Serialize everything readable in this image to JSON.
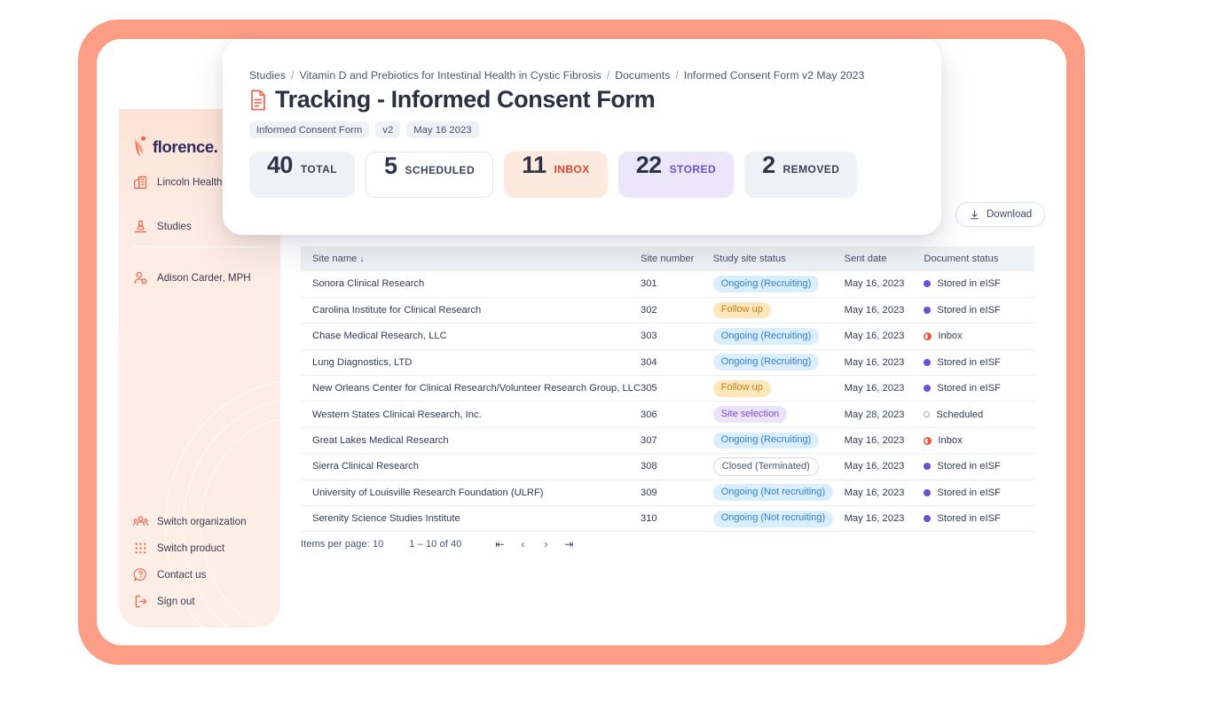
{
  "frame": {
    "accent_color": "#fc9d86"
  },
  "sidebar": {
    "logo_text": "florence.",
    "org": {
      "label": "Lincoln Health",
      "icon": "building-icon"
    },
    "studies": {
      "label": "Studies",
      "icon": "microscope-icon"
    },
    "user": {
      "label": "Adison Carder, MPH",
      "icon": "user-settings-icon"
    },
    "footer_items": [
      {
        "label": "Switch organization",
        "icon": "people-switch-icon"
      },
      {
        "label": "Switch product",
        "icon": "grid-dots-icon"
      },
      {
        "label": "Contact us",
        "icon": "question-chat-icon"
      },
      {
        "label": "Sign out",
        "icon": "sign-out-icon"
      }
    ]
  },
  "toolbar": {
    "download_label": "Download",
    "download_icon": "download-icon"
  },
  "overlay": {
    "breadcrumb": [
      "Studies",
      "Vitamin D and Prebiotics for Intestinal Health in Cystic Fibrosis",
      "Documents",
      "Informed Consent Form v2 May 2023"
    ],
    "breadcrumb_separator": "/",
    "title": "Tracking - Informed Consent Form",
    "title_icon": "document-icon",
    "chips": [
      "Informed Consent Form",
      "v2",
      "May 16 2023"
    ],
    "stats": [
      {
        "number": "40",
        "caption": "TOTAL",
        "key": "total"
      },
      {
        "number": "5",
        "caption": "SCHEDULED",
        "key": "sched"
      },
      {
        "number": "11",
        "caption": "INBOX",
        "key": "inbox"
      },
      {
        "number": "22",
        "caption": "STORED",
        "key": "stored"
      },
      {
        "number": "2",
        "caption": "REMOVED",
        "key": "removed"
      }
    ]
  },
  "table": {
    "columns": [
      {
        "label": "Site name",
        "sorted": true,
        "sort_dir": "↓"
      },
      {
        "label": "Site number"
      },
      {
        "label": "Study site status"
      },
      {
        "label": "Sent date"
      },
      {
        "label": "Document status"
      }
    ],
    "sort_arrow": "↓",
    "rows": [
      {
        "site_name": "Sonora Clinical Research",
        "site_number": "301",
        "study_site_status": "Ongoing (Recruiting)",
        "status_style": "blue",
        "sent_date": "May 16, 2023",
        "document_status": "Stored in eISF",
        "doc_style": "stored"
      },
      {
        "site_name": "Carolina Institute for Clinical Research",
        "site_number": "302",
        "study_site_status": "Follow up",
        "status_style": "amber",
        "sent_date": "May 16, 2023",
        "document_status": "Stored in eISF",
        "doc_style": "stored"
      },
      {
        "site_name": "Chase Medical Research, LLC",
        "site_number": "303",
        "study_site_status": "Ongoing (Recruiting)",
        "status_style": "blue",
        "sent_date": "May 16, 2023",
        "document_status": "Inbox",
        "doc_style": "inbox"
      },
      {
        "site_name": "Lung Diagnostics, LTD",
        "site_number": "304",
        "study_site_status": "Ongoing (Recruiting)",
        "status_style": "blue",
        "sent_date": "May 16, 2023",
        "document_status": "Stored in eISF",
        "doc_style": "stored"
      },
      {
        "site_name": "New Orleans Center for Clinical Research/Volunteer Research Group, LLC",
        "site_number": "305",
        "study_site_status": "Follow up",
        "status_style": "amber",
        "sent_date": "May 16, 2023",
        "document_status": "Stored in eISF",
        "doc_style": "stored"
      },
      {
        "site_name": "Western States Clinical Research, Inc.",
        "site_number": "306",
        "study_site_status": "Site selection",
        "status_style": "violet",
        "sent_date": "May 28, 2023",
        "document_status": "Scheduled",
        "doc_style": "sched"
      },
      {
        "site_name": "Great Lakes Medical Research",
        "site_number": "307",
        "study_site_status": "Ongoing (Recruiting)",
        "status_style": "blue",
        "sent_date": "May 16, 2023",
        "document_status": "Inbox",
        "doc_style": "inbox"
      },
      {
        "site_name": "Sierra Clinical Research",
        "site_number": "308",
        "study_site_status": "Closed (Terminated)",
        "status_style": "outline",
        "sent_date": "May 16, 2023",
        "document_status": "Stored in eISF",
        "doc_style": "stored"
      },
      {
        "site_name": "University of Louisville Research Foundation (ULRF)",
        "site_number": "309",
        "study_site_status": "Ongoing (Not recruiting)",
        "status_style": "blue",
        "sent_date": "May 16, 2023",
        "document_status": "Stored in eISF",
        "doc_style": "stored"
      },
      {
        "site_name": "Serenity Science Studies Institute",
        "site_number": "310",
        "study_site_status": "Ongoing (Not recruiting)",
        "status_style": "blue",
        "sent_date": "May 16, 2023",
        "document_status": "Stored in eISF",
        "doc_style": "stored"
      }
    ]
  },
  "pagination": {
    "items_per_page_label": "Items per page: 10",
    "range_label": "1 – 10 of 40",
    "first": "⇤",
    "prev": "‹",
    "next": "›",
    "last": "⇥"
  }
}
